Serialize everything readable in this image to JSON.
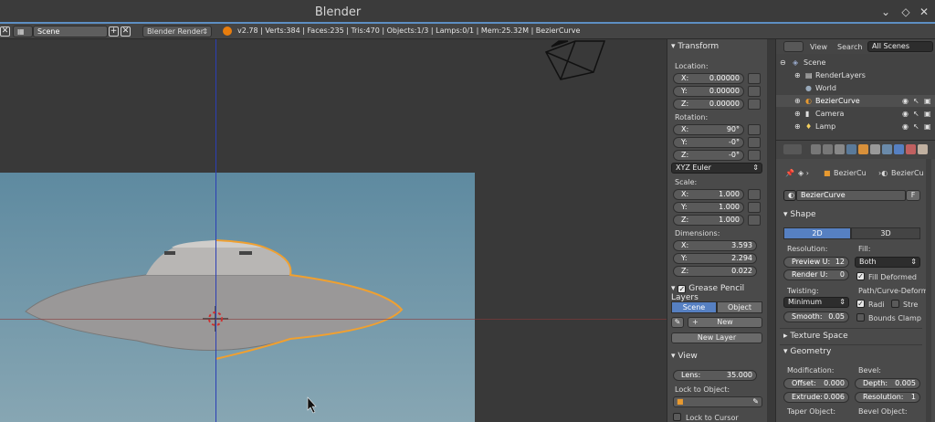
{
  "window": {
    "title": "Blender"
  },
  "infobar": {
    "scene_name": "Scene",
    "render_engine": "Blender Render",
    "stats": "v2.78 | Verts:384 | Faces:235 | Tris:470 | Objects:1/3 | Lamps:0/1 | Mem:25.32M | BezierCurve"
  },
  "npanel": {
    "transform": {
      "header": "Transform",
      "location_label": "Location:",
      "location": [
        {
          "k": "X:",
          "v": "0.00000"
        },
        {
          "k": "Y:",
          "v": "0.00000"
        },
        {
          "k": "Z:",
          "v": "0.00000"
        }
      ],
      "rotation_label": "Rotation:",
      "rotation": [
        {
          "k": "X:",
          "v": "90°"
        },
        {
          "k": "Y:",
          "v": "-0°"
        },
        {
          "k": "Z:",
          "v": "-0°"
        }
      ],
      "rotation_mode": "XYZ Euler",
      "scale_label": "Scale:",
      "scale": [
        {
          "k": "X:",
          "v": "1.000"
        },
        {
          "k": "Y:",
          "v": "1.000"
        },
        {
          "k": "Z:",
          "v": "1.000"
        }
      ],
      "dimensions_label": "Dimensions:",
      "dimensions": [
        {
          "k": "X:",
          "v": "3.593"
        },
        {
          "k": "Y:",
          "v": "2.294"
        },
        {
          "k": "Z:",
          "v": "0.022"
        }
      ]
    },
    "grease": {
      "header": "Grease Pencil Layers",
      "tab_scene": "Scene",
      "tab_object": "Object",
      "new_label": "New",
      "new_layer_label": "New Layer"
    },
    "view": {
      "header": "View",
      "lens_label": "Lens:",
      "lens_value": "35.000",
      "lock_object_label": "Lock to Object:",
      "lock_cursor_label": "Lock to Cursor"
    }
  },
  "outliner": {
    "view_label": "View",
    "search_label": "Search",
    "filter": "All Scenes",
    "rows": [
      {
        "name": "Scene"
      },
      {
        "name": "RenderLayers"
      },
      {
        "name": "World"
      },
      {
        "name": "BezierCurve"
      },
      {
        "name": "Camera"
      },
      {
        "name": "Lamp"
      }
    ]
  },
  "properties": {
    "breadcrumb_object": "BezierCu",
    "breadcrumb_data": "BezierCu",
    "datablock_name": "BezierCurve",
    "fake_user": "F",
    "shape": {
      "header": "Shape",
      "tab_2d": "2D",
      "tab_3d": "3D",
      "resolution_label": "Resolution:",
      "preview_u_label": "Preview U:",
      "preview_u_value": "12",
      "render_u_label": "Render U:",
      "render_u_value": "0",
      "fill_label": "Fill:",
      "fill_value": "Both",
      "fill_deformed_label": "Fill Deformed",
      "twisting_label": "Twisting:",
      "twisting_value": "Minimum",
      "smooth_label": "Smooth:",
      "smooth_value": "0.05",
      "path_deform_label": "Path/Curve-Deform:",
      "radius_label": "Radi",
      "stretch_label": "Stre",
      "bounds_clamp_label": "Bounds Clamp"
    },
    "texture_space_header": "Texture Space",
    "geometry": {
      "header": "Geometry",
      "modification_label": "Modification:",
      "offset_label": "Offset:",
      "offset_value": "0.000",
      "extrude_label": "Extrude:",
      "extrude_value": "0.006",
      "bevel_label": "Bevel:",
      "depth_label": "Depth:",
      "depth_value": "0.005",
      "resolution_label": "Resolution:",
      "resolution_value": "1",
      "taper_object_label": "Taper Object:",
      "bevel_object_label": "Bevel Object:"
    }
  }
}
